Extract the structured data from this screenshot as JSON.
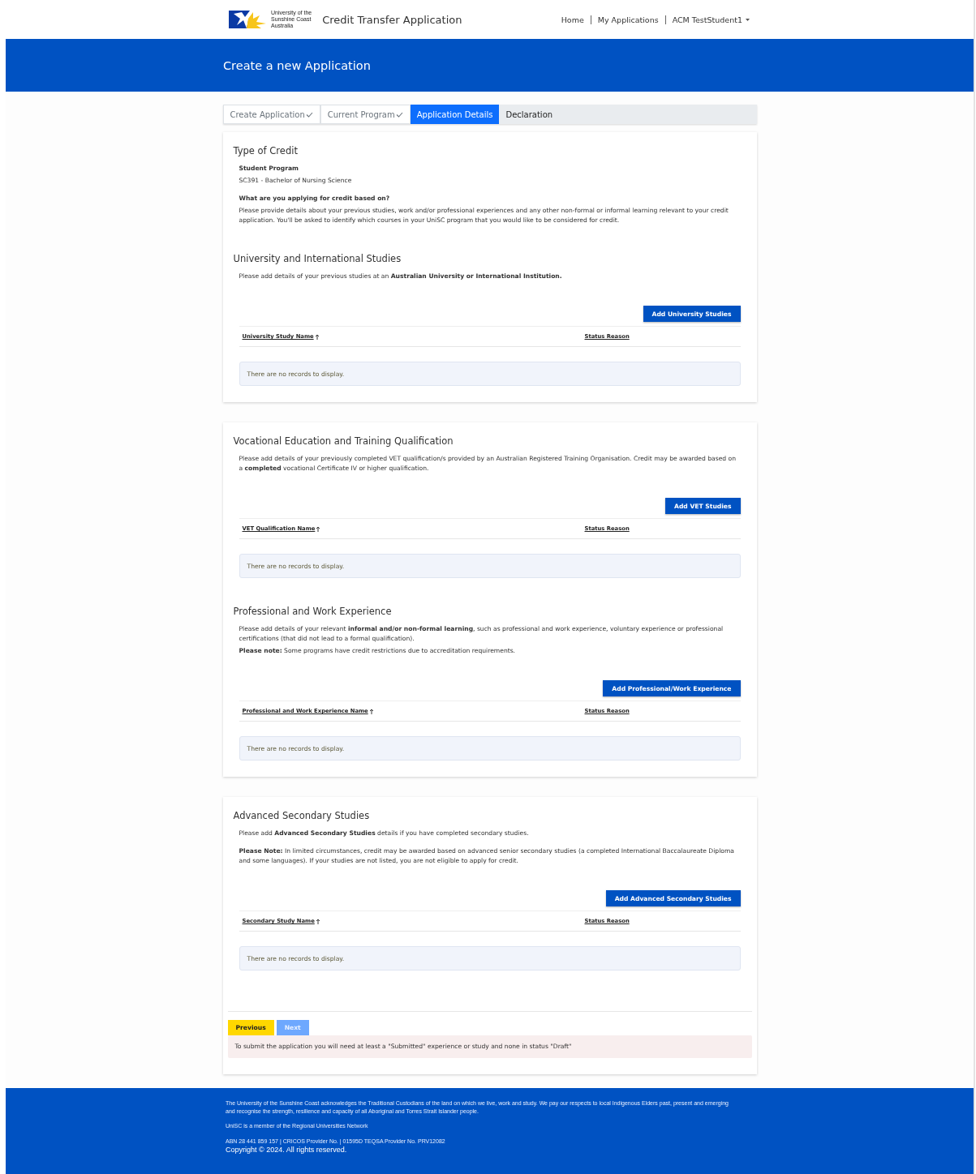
{
  "header": {
    "logo_lines": [
      "University of the",
      "Sunshine Coast",
      "Australia"
    ],
    "app_title": "Credit Transfer Application",
    "nav": [
      {
        "label": "Home",
        "kind": "link"
      },
      {
        "label": "My Applications",
        "kind": "link"
      },
      {
        "label": "ACM TestStudent1",
        "kind": "dropdown"
      }
    ]
  },
  "banner": {
    "title": "Create a new Application"
  },
  "tabs": [
    {
      "label": "Create Application",
      "completed": true,
      "selected": false
    },
    {
      "label": "Current Program",
      "completed": true,
      "selected": false
    },
    {
      "label": "Application Details",
      "completed": false,
      "selected": true
    },
    {
      "label": "Declaration",
      "completed": false,
      "selected": false
    }
  ],
  "cards": [
    {
      "blocks": [
        {
          "kind": "info",
          "title": "Type of Credit",
          "lines": [
            {
              "kind": "label",
              "text": "Student Program"
            },
            {
              "kind": "text",
              "text": "SC391 - Bachelor of Nursing Science"
            },
            {
              "kind": "label",
              "text": "What are you applying for credit based on?",
              "gap": true
            },
            {
              "kind": "text",
              "text": "Please provide details about your previous studies, work and/or professional experiences and any other non-formal or informal learning relevant to your credit application. You'll be asked to identify which courses in your UniSC program that you would like to be considered for credit."
            }
          ]
        },
        {
          "kind": "table",
          "title": "University and International Studies",
          "lines": [
            {
              "kind": "text",
              "text": "Please add details of your previous studies at an **Australian University or International Institution.**"
            }
          ],
          "button": "Add University Studies",
          "columns": [
            {
              "label": "University Study Name",
              "sorted": true
            },
            {
              "label": "Status Reason",
              "sorted": false
            }
          ],
          "empty": "There are no records to display."
        }
      ]
    },
    {
      "blocks": [
        {
          "kind": "table",
          "title": "Vocational Education and Training Qualification",
          "lines": [
            {
              "kind": "text",
              "text": "Please add details of your previously completed VET qualification/s provided by an Australian Registered Training Organisation. Credit may be awarded based on a **completed** vocational Certificate IV or higher qualification."
            }
          ],
          "button": "Add VET Studies",
          "columns": [
            {
              "label": "VET Qualification Name",
              "sorted": true
            },
            {
              "label": "Status Reason",
              "sorted": false
            }
          ],
          "empty": "There are no records to display."
        },
        {
          "kind": "table",
          "title": "Professional and Work Experience",
          "lines": [
            {
              "kind": "text",
              "text": "Please add details of your relevant **informal and/or non-formal learning**, such as professional and work experience, voluntary experience or professional certifications (that did not lead to a formal qualification)."
            },
            {
              "kind": "text",
              "text": "**Please note:** Some programs have credit restrictions due to accreditation requirements."
            }
          ],
          "button": "Add Professional/Work Experience",
          "columns": [
            {
              "label": "Professional and Work Experience Name",
              "sorted": true
            },
            {
              "label": "Status Reason",
              "sorted": false
            }
          ],
          "empty": "There are no records to display."
        }
      ]
    },
    {
      "blocks": [
        {
          "kind": "table",
          "title": "Advanced Secondary Studies",
          "lines": [
            {
              "kind": "text",
              "text": "Please add **Advanced Secondary Studies** details if you have completed secondary studies."
            },
            {
              "kind": "text",
              "text": "**Please Note:** In limited circumstances, credit may be awarded based on advanced senior secondary studies (a completed International Baccalaureate Diploma and some languages). If your studies are not listed, you are not eligible to apply for credit.",
              "gap": true
            }
          ],
          "button": "Add Advanced Secondary Studies",
          "columns": [
            {
              "label": "Secondary Study Name",
              "sorted": true
            },
            {
              "label": "Status Reason",
              "sorted": false
            }
          ],
          "empty": "There are no records to display."
        }
      ],
      "actions": [
        {
          "label": "Previous",
          "disabled": false
        },
        {
          "label": "Next",
          "disabled": true
        }
      ],
      "alert": "To submit the application you will need at least a \"Submitted\" experience or study and none in status \"Draft\""
    }
  ],
  "footer": {
    "acknowledgement": "The University of the Sunshine Coast acknowledges the Traditional Custodians of the land on which we live, work and study. We pay our respects to local Indigenous Elders past, present and emerging and recognise the strength, resilience and capacity of all Aboriginal and Torres Strait Islander people.",
    "network": "UniSC is a member of the Regional Universities Network",
    "provider": "ABN 28 441 859 157 | CRICOS Provider No. | 01595D TEQSA Provider No. PRV12082",
    "copyright": "Copyright © 2024. All rights reserved."
  }
}
